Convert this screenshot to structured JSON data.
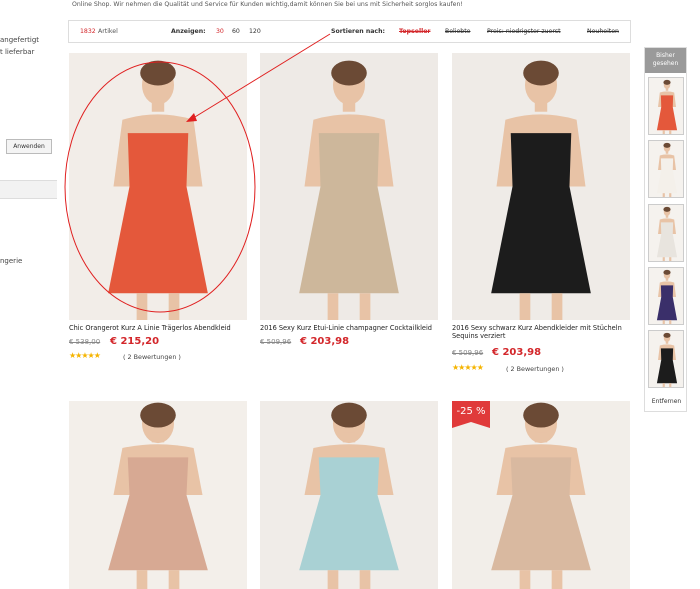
{
  "filters": {
    "item1": "angefertigt",
    "item2": "t lieferbar",
    "apply_label": "Anwenden",
    "item3": "ngerie"
  },
  "header": {
    "intro": "Online Shop. Wir nehmen die Qualität und Service für Kunden wichtig,damit können Sie bei uns mit Sicherheit sorglos kaufen!"
  },
  "toolbar": {
    "count": "1832",
    "count_label": "Artikel",
    "show_label": "Anzeigen:",
    "pages": [
      "30",
      "60",
      "120"
    ],
    "sort_label": "Sortieren nach:",
    "sort_options": [
      "Topseller",
      "Beliebte",
      "Preis: niedrigster zuerst",
      "Neuheiten"
    ]
  },
  "products": [
    {
      "name": "Chic Orangerot Kurz A Linie Trägerlos Abendkleid",
      "old_price": "€ 538,00",
      "price": "€ 215,20",
      "reviews": "( 2 Bewertungen )",
      "dress_color": "#e4583b"
    },
    {
      "name": "2016 Sexy Kurz Etui-Linie champagner Cocktailkleid",
      "old_price": "€ 509,96",
      "price": "€ 203,98",
      "dress_color": "#cdb79b"
    },
    {
      "name": "2016 Sexy schwarz Kurz Abendkleider mit Stücheln Sequins verziert",
      "old_price": "€ 509,96",
      "price": "€ 203,98",
      "reviews": "( 2 Bewertungen )",
      "dress_color": "#1c1c1c"
    },
    {
      "dress_color": "#d7a993"
    },
    {
      "dress_color": "#a9d1d4"
    },
    {
      "dress_color": "#d9b9a0",
      "badge": "-25 %"
    }
  ],
  "recent": {
    "title": "Bisher gesehen",
    "remove_label": "Entfernen",
    "thumb_colors": [
      "#e4583b",
      "#f4f0ea",
      "#e8e4de",
      "#3a2f6a",
      "#1c1c1c"
    ]
  },
  "colors": {
    "accent": "#d3262a",
    "star": "#f5b400",
    "annotation": "#e02020"
  }
}
